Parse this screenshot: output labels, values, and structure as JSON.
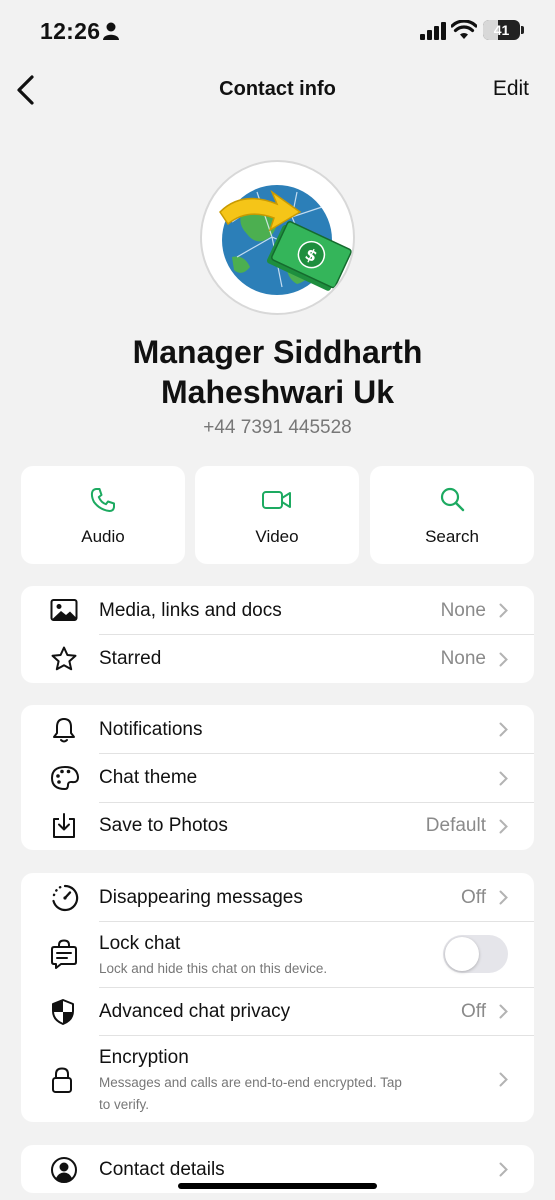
{
  "status_bar": {
    "time": "12:26",
    "battery": "41"
  },
  "nav": {
    "title": "Contact info",
    "edit_label": "Edit"
  },
  "profile": {
    "name_line1": "Manager Siddharth",
    "name_line2": "Maheshwari Uk",
    "phone": "+44 7391 445528"
  },
  "actions": [
    {
      "label": "Audio",
      "icon": "phone-icon"
    },
    {
      "label": "Video",
      "icon": "video-icon"
    },
    {
      "label": "Search",
      "icon": "search-icon"
    }
  ],
  "media_group": {
    "media": {
      "label": "Media, links and docs",
      "value": "None",
      "icon": "image-icon"
    },
    "starred": {
      "label": "Starred",
      "value": "None",
      "icon": "star-icon"
    }
  },
  "settings_group": {
    "notifications": {
      "label": "Notifications",
      "icon": "bell-icon"
    },
    "chat_theme": {
      "label": "Chat theme",
      "icon": "palette-icon"
    },
    "save_to_photos": {
      "label": "Save to Photos",
      "value": "Default",
      "icon": "download-icon"
    }
  },
  "privacy_group": {
    "disappearing": {
      "label": "Disappearing messages",
      "value": "Off",
      "icon": "timer-icon"
    },
    "lock_chat": {
      "label": "Lock chat",
      "sub": "Lock and hide this chat on this device.",
      "toggle_on": false,
      "icon": "lock-chat-icon"
    },
    "advanced_privacy": {
      "label": "Advanced chat privacy",
      "value": "Off",
      "icon": "shield-icon"
    },
    "encryption": {
      "label": "Encryption",
      "sub_line1": "Messages and calls are end-to-end encrypted. Tap",
      "sub_line2": "to verify.",
      "icon": "lock-icon"
    }
  },
  "contact_group": {
    "contact_details": {
      "label": "Contact details",
      "icon": "person-circle-icon"
    }
  },
  "colors": {
    "accent": "#1daa61",
    "background": "#f2f2f2",
    "card": "#ffffff",
    "secondary_text": "#8a8a8a"
  }
}
